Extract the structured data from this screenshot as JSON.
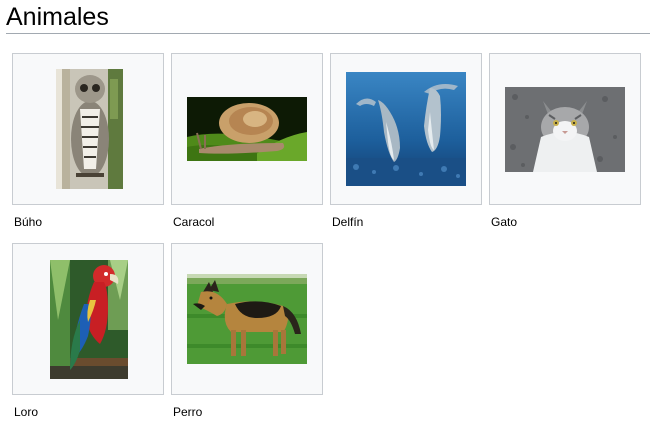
{
  "page": {
    "title": "Animales"
  },
  "gallery": {
    "items": [
      {
        "caption": "Búho",
        "icon": "owl-image"
      },
      {
        "caption": "Caracol",
        "icon": "snail-image"
      },
      {
        "caption": "Delfín",
        "icon": "dolphin-image"
      },
      {
        "caption": "Gato",
        "icon": "cat-image"
      },
      {
        "caption": "Loro",
        "icon": "parrot-image"
      },
      {
        "caption": "Perro",
        "icon": "dog-image"
      }
    ]
  }
}
